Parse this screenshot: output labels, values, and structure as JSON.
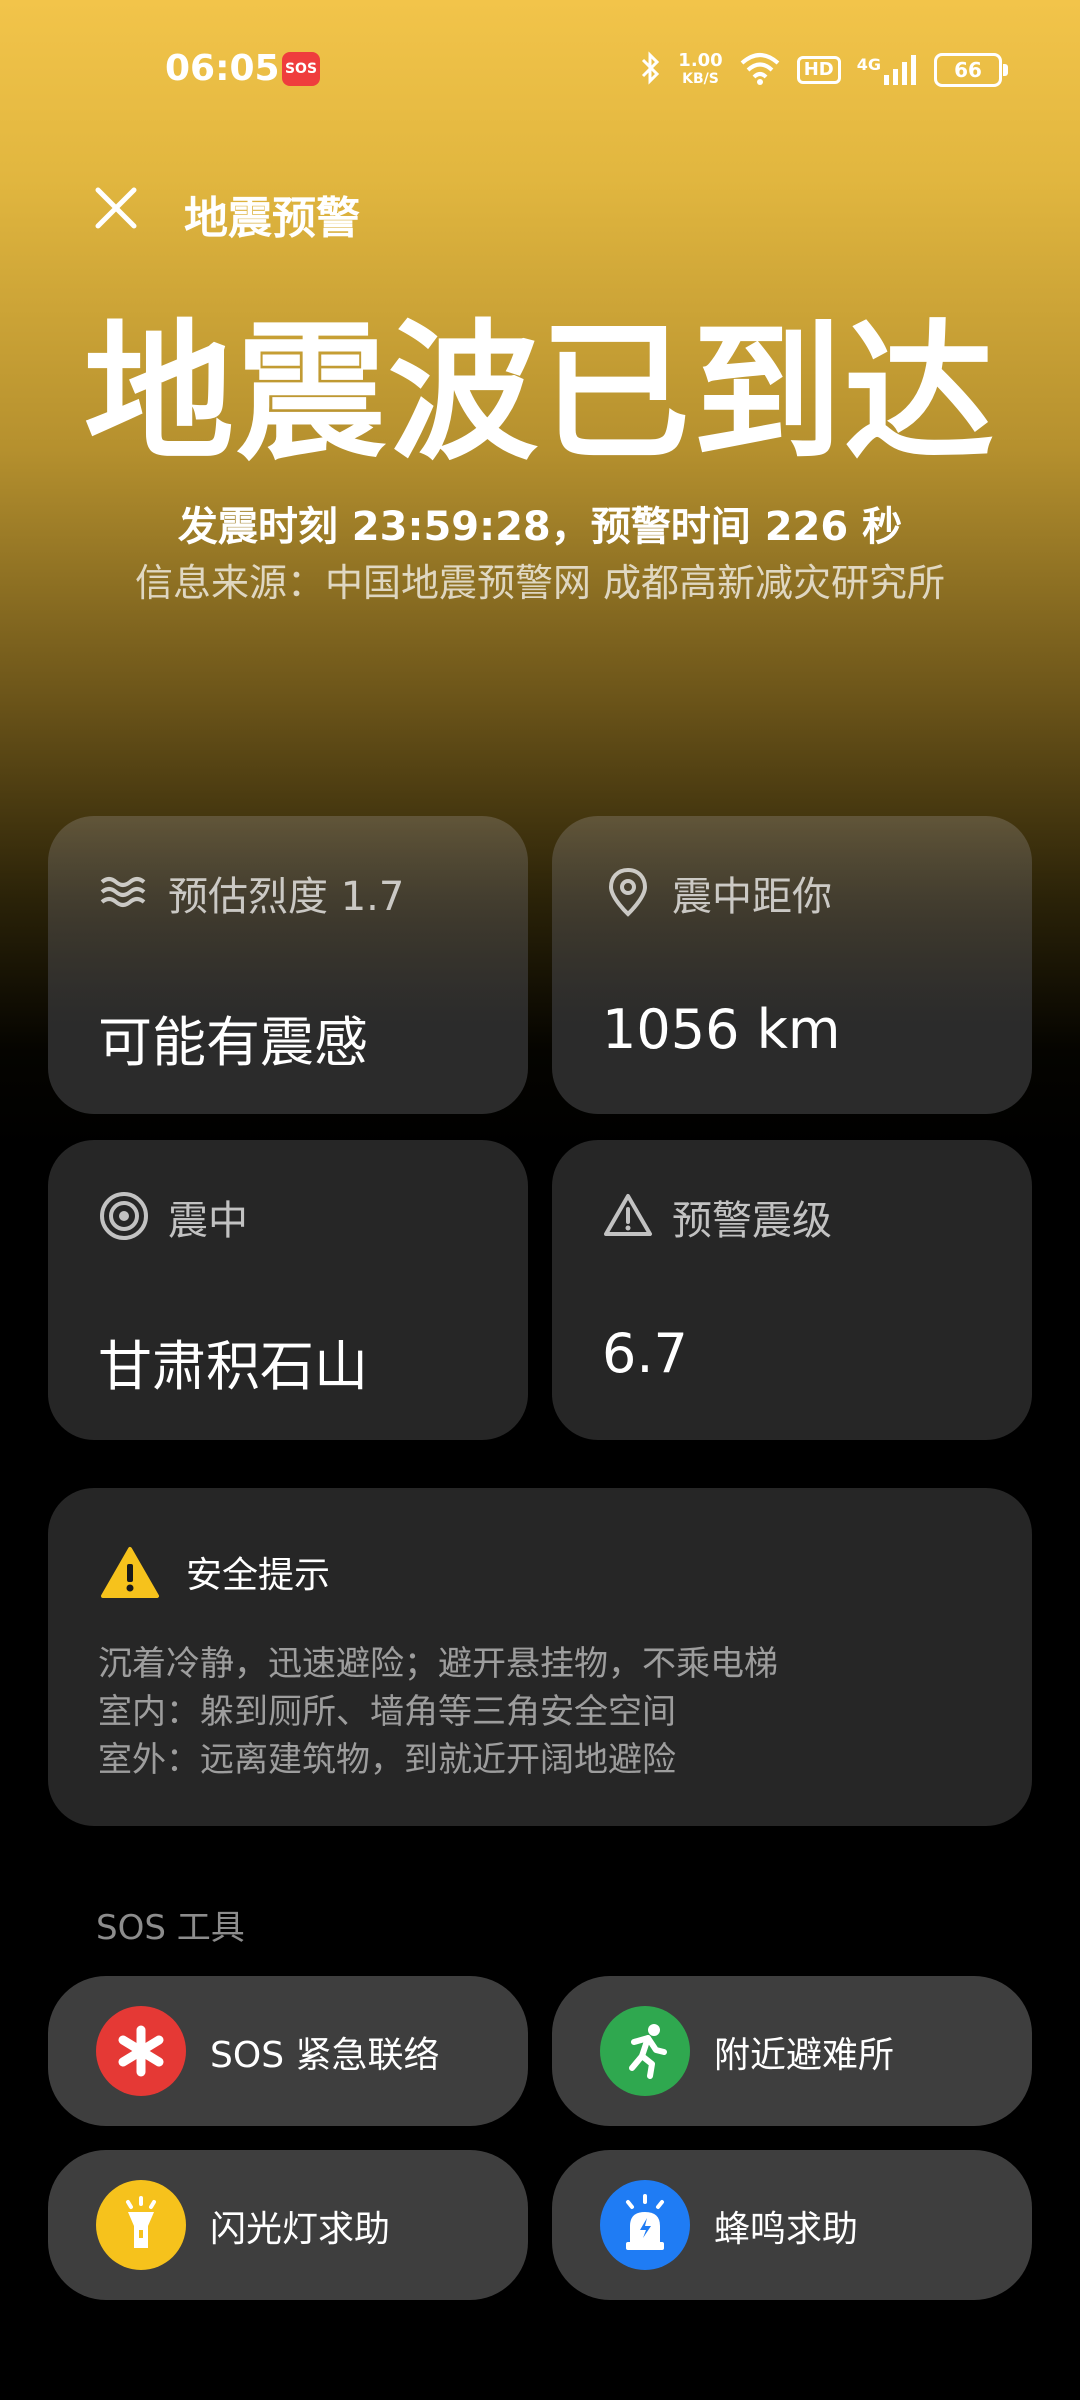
{
  "status_bar": {
    "time": "06:05",
    "sos_badge": "SOS",
    "net_speed_value": "1.00",
    "net_speed_unit": "KB/S",
    "hd": "HD",
    "network": "4G",
    "battery": "66"
  },
  "header": {
    "title": "地震预警"
  },
  "hero": {
    "headline": "地震波已到达",
    "event_line": "发震时刻 23:59:28，预警时间 226 秒",
    "source_line": "信息来源：中国地震预警网 成都高新减灾研究所"
  },
  "cards": {
    "intensity": {
      "label": "预估烈度 1.7",
      "value": "可能有震感",
      "icon": "waves-icon"
    },
    "distance": {
      "label": "震中距你",
      "value": "1056 km",
      "icon": "location-pin-icon"
    },
    "epicenter": {
      "label": "震中",
      "value": "甘肃积石山",
      "icon": "target-icon"
    },
    "magnitude": {
      "label": "预警震级",
      "value": "6.7",
      "icon": "warning-outline-icon"
    }
  },
  "safety": {
    "title": "安全提示",
    "lines": [
      "沉着冷静，迅速避险；避开悬挂物，不乘电梯",
      "室内：躲到厕所、墙角等三角安全空间",
      "室外：远离建筑物，到就近开阔地避险"
    ]
  },
  "sos_tools": {
    "section_label": "SOS 工具",
    "items": [
      {
        "label": "SOS 紧急联络",
        "color": "#e53935",
        "icon": "asterisk-icon"
      },
      {
        "label": "附近避难所",
        "color": "#2fa84f",
        "icon": "running-person-icon"
      },
      {
        "label": "闪光灯求助",
        "color": "#f6c21c",
        "icon": "flashlight-icon"
      },
      {
        "label": "蜂鸣求助",
        "color": "#1f7cf4",
        "icon": "alarm-siren-icon"
      }
    ]
  },
  "colors": {
    "header_gradient_top": "#f2c44a",
    "card_bg": "#262626",
    "tool_bg": "#3e3e3e",
    "warn_yellow": "#f6c21c"
  }
}
